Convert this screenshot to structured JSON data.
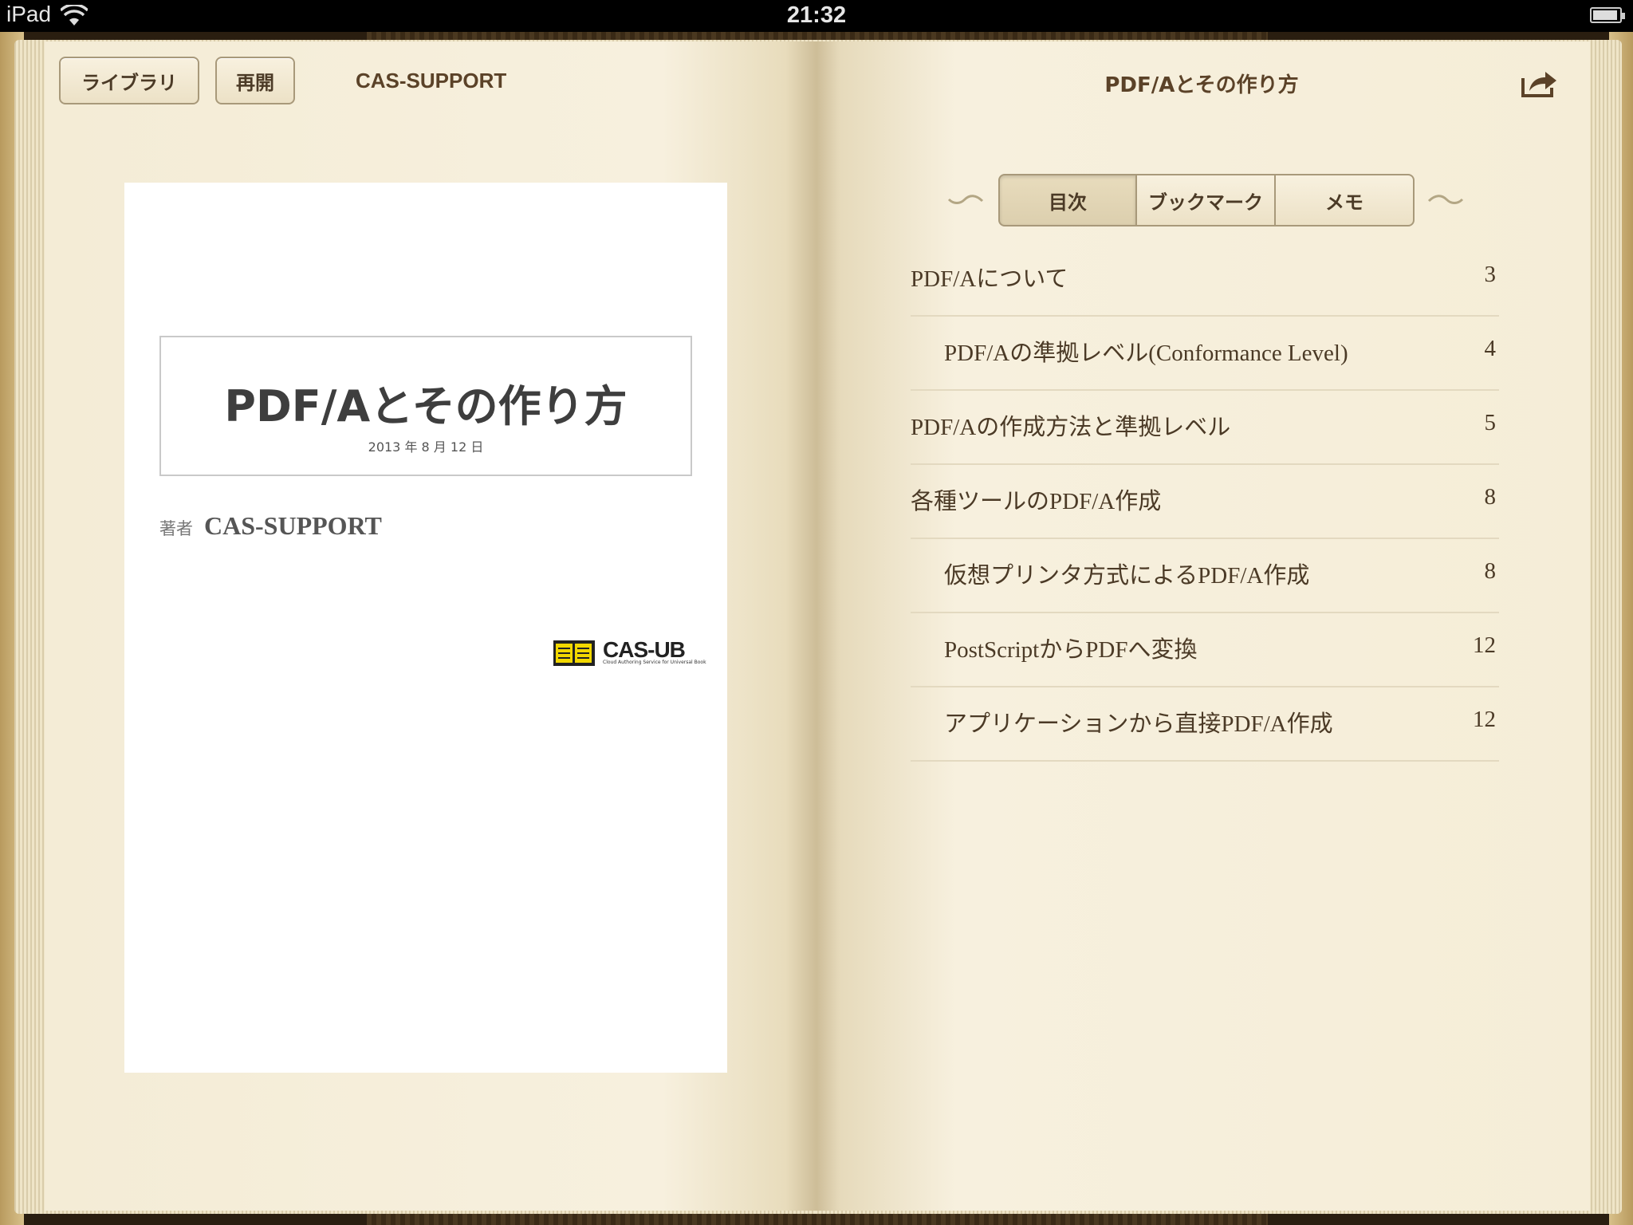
{
  "status_bar": {
    "device": "iPad",
    "time": "21:32"
  },
  "toolbar_left": {
    "library_label": "ライブラリ",
    "resume_label": "再開",
    "author": "CAS-SUPPORT"
  },
  "toolbar_right": {
    "book_title": "PDF/Aとその作り方"
  },
  "cover": {
    "title": "PDF/Aとその作り方",
    "date": "2013 年 8 月 12 日",
    "author_label": "著者",
    "author_name": "CAS-SUPPORT",
    "logo_text": "CAS-UB",
    "logo_sub": "Cloud Authoring Service for Universal Book"
  },
  "segments": {
    "toc": "目次",
    "bookmarks": "ブックマーク",
    "memo": "メモ",
    "selected": "toc"
  },
  "toc": [
    {
      "title": "PDF/Aについて",
      "page": "3",
      "indent": 0
    },
    {
      "title": "PDF/Aの準拠レベル(Conformance Level)",
      "page": "4",
      "indent": 1
    },
    {
      "title": "PDF/Aの作成方法と準拠レベル",
      "page": "5",
      "indent": 0
    },
    {
      "title": "各種ツールのPDF/A作成",
      "page": "8",
      "indent": 0
    },
    {
      "title": "仮想プリンタ方式によるPDF/A作成",
      "page": "8",
      "indent": 1
    },
    {
      "title": "PostScriptからPDFへ変換",
      "page": "12",
      "indent": 1
    },
    {
      "title": "アプリケーションから直接PDF/A作成",
      "page": "12",
      "indent": 1
    }
  ],
  "colors": {
    "page": "#f5edd7",
    "text": "#4b3a26",
    "button_border": "#a8997a"
  }
}
